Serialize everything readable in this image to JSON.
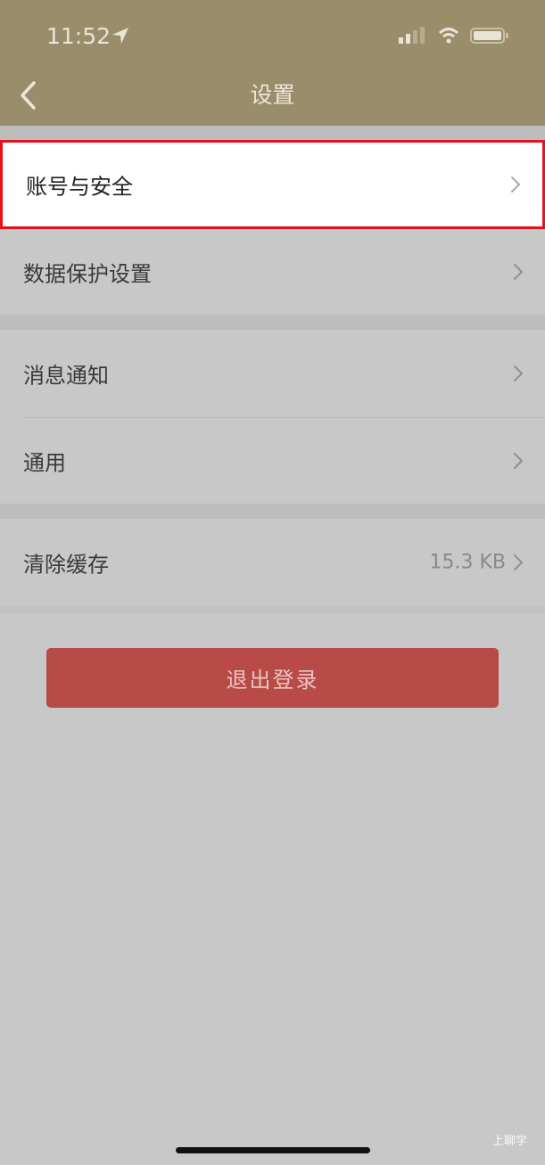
{
  "status_bar": {
    "time": "11:52"
  },
  "nav": {
    "title": "设置"
  },
  "settings": {
    "account_security": "账号与安全",
    "data_protection": "数据保护设置",
    "notifications": "消息通知",
    "general": "通用",
    "clear_cache": "清除缓存",
    "cache_size": "15.3 KB"
  },
  "logout_label": "退出登录",
  "watermark": "上聊学",
  "colors": {
    "header": "#9a8d6c",
    "background": "#c8c8c8",
    "highlight_border": "#e8101a",
    "logout_button": "#b84a47"
  }
}
